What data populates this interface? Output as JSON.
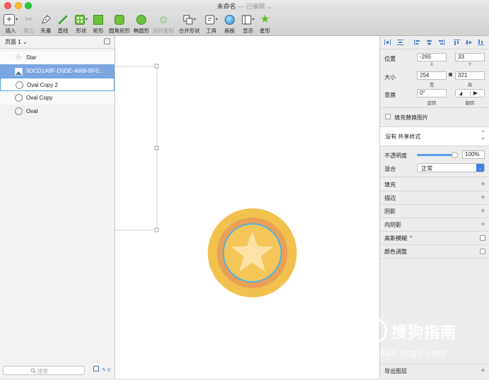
{
  "window": {
    "title": "未命名",
    "edited": " — 已编辑 ⌄"
  },
  "toolbar": {
    "insert": "插入",
    "scissors": "剪刀",
    "vector": "矢量",
    "line": "直线",
    "shape": "形状",
    "rect": "矩形",
    "rounded": "圆角矩形",
    "oval": "椭圆形",
    "rotate_copy": "旋转复制",
    "combine": "合并形状",
    "tools": "工具",
    "artboard": "画板",
    "view": "显示",
    "star": "星形"
  },
  "leftpanel": {
    "page": "页面 1 ⌄",
    "layers": [
      {
        "name": "Star"
      },
      {
        "name": "9DCD1A8F-D5DE-4668-BF0..."
      },
      {
        "name": "Oval Copy 2"
      },
      {
        "name": "Oval Copy"
      },
      {
        "name": "Oval"
      }
    ],
    "search_placeholder": "搜索",
    "footer_count": "0"
  },
  "inspector": {
    "position_label": "位置",
    "x": "-265",
    "y": "33",
    "x_sub": "X",
    "y_sub": "Y",
    "size_label": "大小",
    "w": "254",
    "h": "321",
    "w_sub": "宽",
    "h_sub": "高",
    "transform_label": "变换",
    "rotation": "0°",
    "rotation_sub": "旋转",
    "flip_sub": "翻转",
    "fill_replace": "填充替换图片",
    "shared_style": "没有 共享样式",
    "opacity_label": "不透明度",
    "opacity": "100%",
    "blend_label": "混合",
    "blend": "正常",
    "sections": [
      "填充",
      "描边",
      "阴影",
      "内阴影"
    ],
    "blur": "高斯模糊 ⌃",
    "color_adjust": "颜色调整",
    "export": "导出图层"
  },
  "watermark": {
    "brand": "搜狗指南",
    "url": "zhinan.sogo.com"
  },
  "colors": {
    "coin_outer": "#f2c14e",
    "coin_ring": "#e9a055",
    "coin_inner": "#f6c659",
    "coin_stroke": "#4fb3e0",
    "star": "#fbe3a6",
    "selection": "#7aa6e2"
  }
}
